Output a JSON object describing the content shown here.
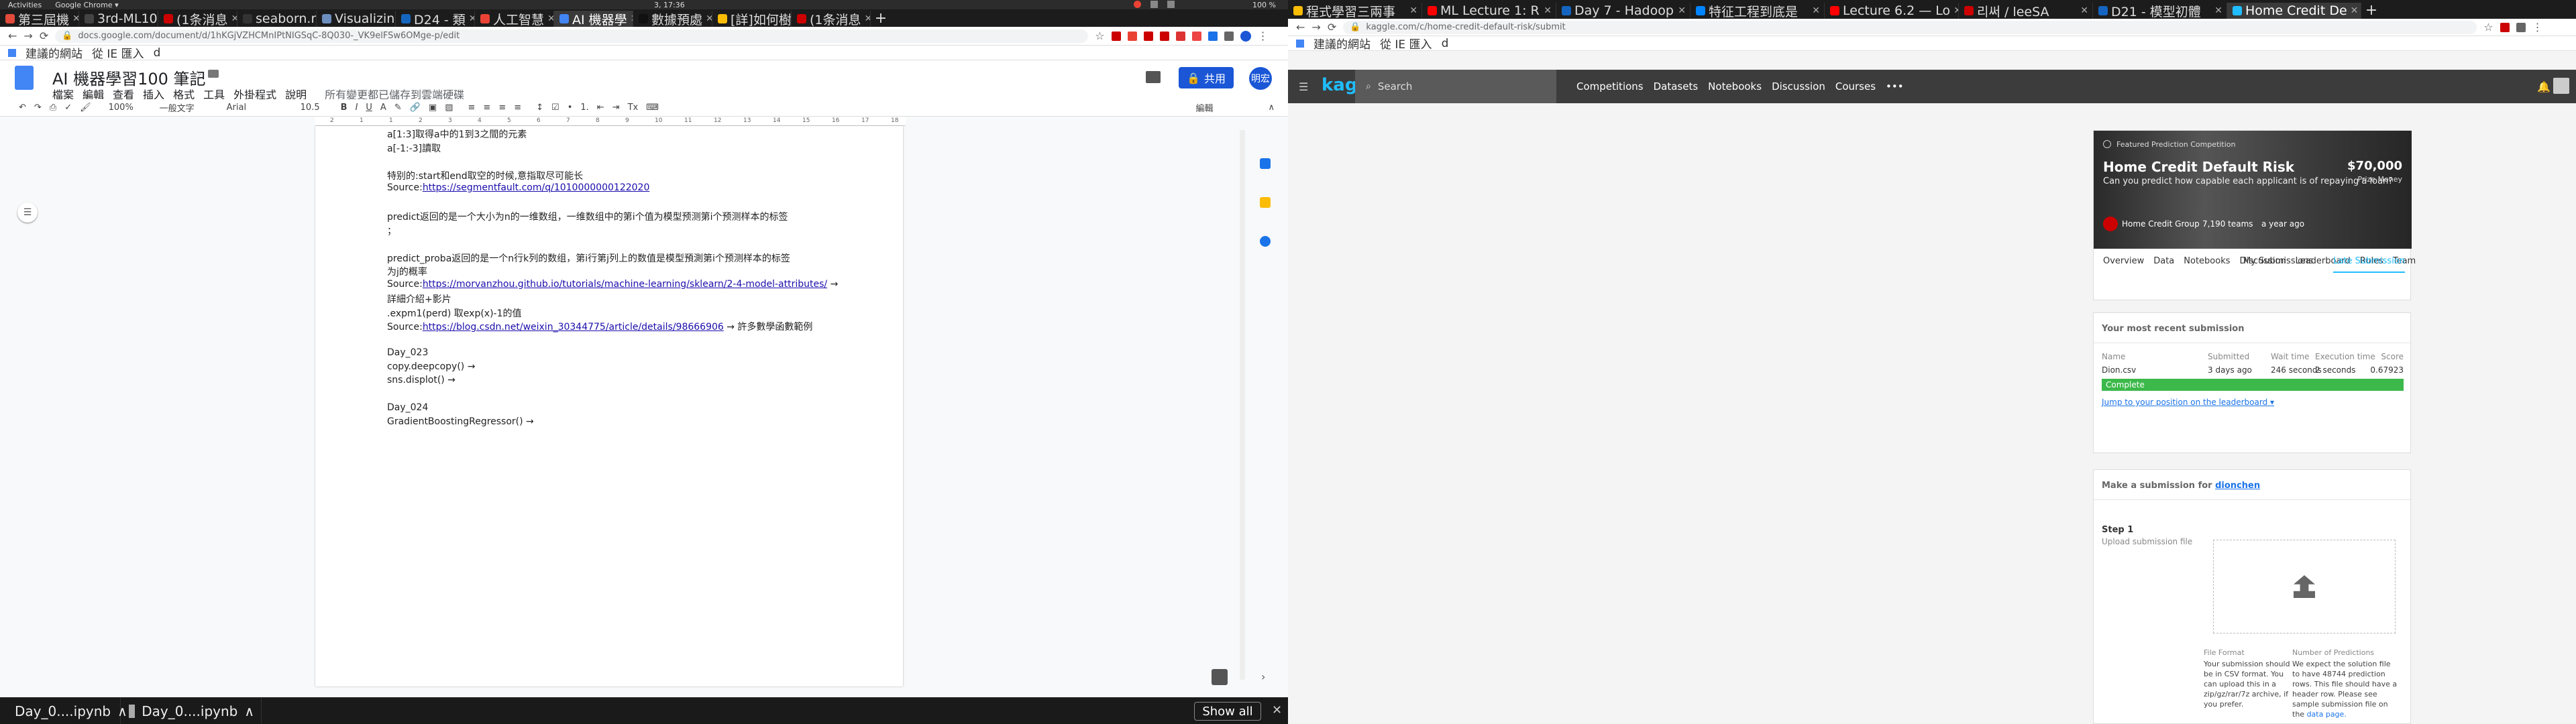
{
  "topbar": {
    "activities": "Activities",
    "app": "Google Chrome ▾",
    "clock": "3, 17:36",
    "battery": "100 %"
  },
  "left": {
    "tabs": [
      {
        "label": "第三屆機",
        "color": "#e24b3b"
      },
      {
        "label": "3rd-ML10",
        "color": "#444"
      },
      {
        "label": "(1条消息",
        "color": "#c00"
      },
      {
        "label": "seaborn.r",
        "color": "#333"
      },
      {
        "label": "Visualizing",
        "color": "#6c8ebf"
      },
      {
        "label": "D24 - 類",
        "color": "#1565c0"
      },
      {
        "label": "人工智慧",
        "color": "#ea4335"
      },
      {
        "label": "AI 機器學",
        "color": "#4285f4"
      },
      {
        "label": "數據預處",
        "color": "#111"
      },
      {
        "label": "[詳]如何樹",
        "color": "#fbbc04"
      },
      {
        "label": "(1条消息",
        "color": "#c00"
      }
    ],
    "url": "docs.google.com/document/d/1hKGjVZHCMnIPtNIGSqC-8Q030-_VK9elFSw6OMge-p/edit",
    "bookmarks": [
      "建議的網站",
      "從 IE 匯入",
      "d"
    ],
    "doc_title": "AI 機器學習100 筆記",
    "menu": [
      "檔案",
      "編輯",
      "查看",
      "插入",
      "格式",
      "工具",
      "外掛程式",
      "說明"
    ],
    "saved_status": "所有變更都已儲存到雲端硬碟",
    "share_label": "共用",
    "avatar_text": "明宏",
    "toolbar": {
      "zoom": "100%",
      "style": "一般文字",
      "font": "Arial",
      "size": "10.5",
      "mode": "編輯"
    },
    "ruler_ticks": [
      "2",
      "1",
      "1",
      "2",
      "3",
      "4",
      "5",
      "6",
      "7",
      "8",
      "9",
      "10",
      "11",
      "12",
      "13",
      "14",
      "15",
      "16",
      "17",
      "18"
    ],
    "doc_lines": [
      {
        "text": "a[1:3]取得a中的1到3之間的元素",
        "link": "",
        "tail": ""
      },
      {
        "text": "a[-1:-3]讀取",
        "link": "",
        "tail": ""
      },
      {
        "text": "",
        "link": "",
        "tail": ""
      },
      {
        "text": "特别的:start和end取空的时候,意指取尽可能长",
        "link": "",
        "tail": ""
      },
      {
        "text": "Source:",
        "link": "https://segmentfault.com/q/1010000000122020",
        "tail": ""
      },
      {
        "text": "",
        "link": "",
        "tail": ""
      },
      {
        "text": " predict返回的是一个大小为n的一维数组，一维数组中的第i个值为模型预测第i个预测样本的标签",
        "link": "",
        "tail": ""
      },
      {
        "text": "；",
        "link": "",
        "tail": ""
      },
      {
        "text": "",
        "link": "",
        "tail": ""
      },
      {
        "text": "    predict_proba返回的是一个n行k列的数组，第i行第j列上的数值是模型預測第i个预测样本的标签",
        "link": "",
        "tail": ""
      },
      {
        "text": "为j的概率",
        "link": "",
        "tail": ""
      },
      {
        "text": "Source:",
        "link": "https://morvanzhou.github.io/tutorials/machine-learning/sklearn/2-4-model-attributes/",
        "tail": " →"
      },
      {
        "text": "詳細介紹+影片",
        "link": "",
        "tail": ""
      },
      {
        "text": ".expm1(perd) 取exp(x)-1的值",
        "link": "",
        "tail": ""
      },
      {
        "text": "Source:",
        "link": "https://blog.csdn.net/weixin_30344775/article/details/98666906",
        "tail": " → 許多數學函數範例"
      },
      {
        "text": "",
        "link": "",
        "tail": ""
      },
      {
        "text": "Day_023",
        "link": "",
        "tail": ""
      },
      {
        "text": "copy.deepcopy() →",
        "link": "",
        "tail": ""
      },
      {
        "text": "sns.displot() →",
        "link": "",
        "tail": ""
      },
      {
        "text": "",
        "link": "",
        "tail": ""
      },
      {
        "text": "Day_024",
        "link": "",
        "tail": ""
      },
      {
        "text": "GradientBoostingRegressor() →",
        "link": "",
        "tail": ""
      }
    ],
    "downloads": [
      "Day_0....ipynb",
      "Day_0....ipynb"
    ],
    "show_all": "Show all"
  },
  "right": {
    "tabs": [
      {
        "label": "程式學習三兩事",
        "color": "#fbbc04"
      },
      {
        "label": "ML Lecture 1: R",
        "color": "#f00"
      },
      {
        "label": "Day 7 - Hadoop",
        "color": "#1565c0"
      },
      {
        "label": "特征工程到底是",
        "color": "#0084ff"
      },
      {
        "label": "Lecture 6.2 — Lo",
        "color": "#f00"
      },
      {
        "label": "리써 / leeSA",
        "color": "#c00"
      },
      {
        "label": "D21 - 模型初體",
        "color": "#1565c0"
      },
      {
        "label": "Home Credit De",
        "color": "#20beff"
      }
    ],
    "url": "kaggle.com/c/home-credit-default-risk/submit",
    "bookmarks": [
      "建議的網站",
      "從 IE 匯入",
      "d"
    ],
    "logo": "kaggle",
    "search_placeholder": "Search",
    "nav": [
      "Competitions",
      "Datasets",
      "Notebooks",
      "Discussion",
      "Courses",
      "•••"
    ],
    "banner": {
      "tag": "Featured Prediction Competition",
      "title": "Home Credit Default Risk",
      "subtitle": "Can you predict how capable each applicant is of repaying a loan?",
      "prize": "$70,000",
      "prize_label": "Prize Money",
      "org": "Home Credit Group",
      "teams": "7,190 teams",
      "age": "a year ago"
    },
    "comp_tabs": [
      "Overview",
      "Data",
      "Notebooks",
      "Discussion",
      "Leaderboard",
      "Rules",
      "Team"
    ],
    "comp_tabs_right": [
      "My Submissions",
      "Late Submission"
    ],
    "recent": {
      "heading": "Your most recent submission",
      "cols": [
        "Name",
        "Submitted",
        "Wait time",
        "Execution time",
        "Score"
      ],
      "vals": [
        "Dion.csv",
        "3 days ago",
        "246 seconds",
        "2 seconds",
        "0.67923"
      ],
      "status": "Complete",
      "jump": "Jump to your position on the leaderboard ▾"
    },
    "submission": {
      "heading_prefix": "Make a submission for",
      "user": "dionchen",
      "step": "Step 1",
      "step_label": "Upload submission file",
      "file_format_title": "File Format",
      "file_format": "Your submission should be in CSV format. You can upload this in a zip/gz/rar/7z archive, if you prefer.",
      "num_pred_title": "Number of Predictions",
      "num_pred": "We expect the solution file to have 48744 prediction rows. This file should have a header row. Please see sample submission file on the",
      "data_page": "data page."
    }
  }
}
